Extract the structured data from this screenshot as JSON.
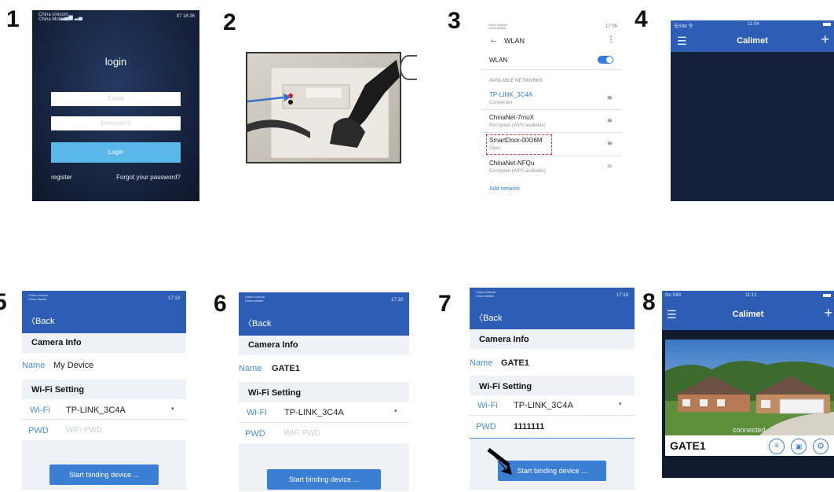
{
  "steps": [
    "1",
    "2",
    "3",
    "4",
    "5",
    "6",
    "7",
    "8"
  ],
  "status": {
    "carriers": "China Unicom\nChina Mobile",
    "s1_time": "87 16:36",
    "s3_time": "17:05",
    "s4_left": "无SIM 令",
    "s4_time": "11:04",
    "s5_time": "17:19",
    "s6_time": "17:19",
    "s7_time": "17:19",
    "s8_left": "No SIM",
    "s8_time": "11:12"
  },
  "login": {
    "title": "login",
    "email_placeholder": "Email",
    "password_placeholder": "password",
    "login_button": "Login",
    "register": "register",
    "forgot": "Forgot your password?"
  },
  "wlan": {
    "title": "WLAN",
    "toggle_label": "WLAN",
    "section": "AVAILABLE NETWORKS",
    "networks": [
      {
        "name": "TP-LINK_3C4A",
        "sub": "Connected"
      },
      {
        "name": "ChinaNet-7muX",
        "sub": "Encrypted (WPS available)"
      },
      {
        "name": "SmartDoor-00O6M",
        "sub": "Open"
      },
      {
        "name": "ChinaNet-NFQu",
        "sub": "Encrypted (WPS available)"
      }
    ],
    "add": "Add network"
  },
  "calimet": {
    "title": "Calimet"
  },
  "form": {
    "back": "Back",
    "camera_info": "Camera Info",
    "name_label": "Name",
    "wifi_setting": "Wi-Fi Setting",
    "wifi_label": "Wi-Fi",
    "wifi_value": "TP-LINK_3C4A",
    "pwd_label": "PWD",
    "pwd_placeholder": "WiFi PWD",
    "start": "Start binding device ...",
    "name5": "My Device",
    "name6": "GATE1",
    "name7": "GATE1",
    "pwd7": "1111111"
  },
  "device": {
    "status": "connected",
    "name": "GATE1"
  },
  "colors": {
    "app_blue": "#2d5db5",
    "button_blue": "#3b7fd5",
    "login_button": "#5ab7ea",
    "dark_bg": "#15213a"
  }
}
